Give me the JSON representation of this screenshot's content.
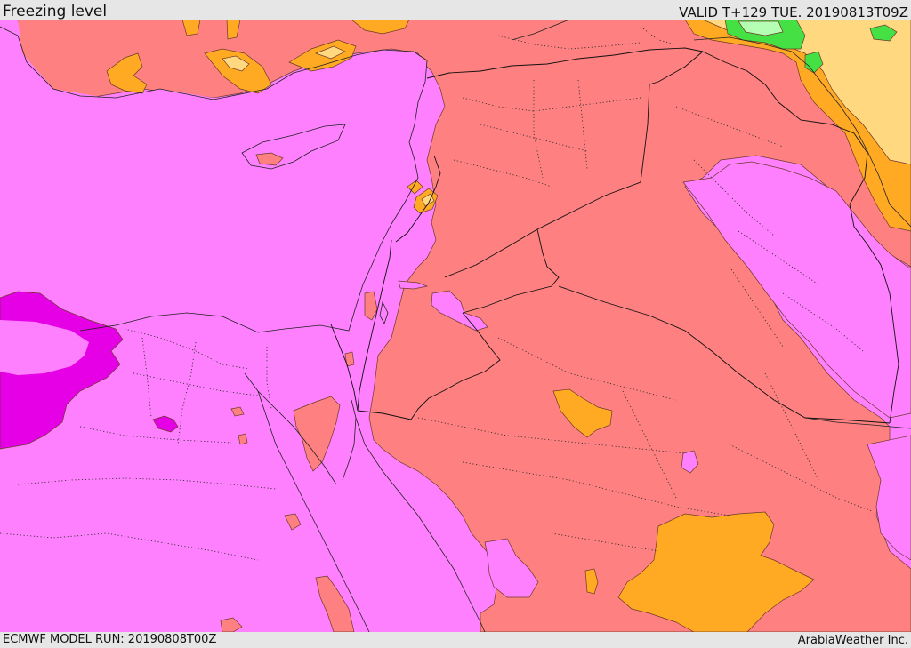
{
  "header": {
    "title": "Freezing level",
    "valid": "VALID T+129 TUE. 20190813T09Z"
  },
  "footer": {
    "model_run": "ECMWF MODEL RUN: 20190808T00Z",
    "credit": "ArabiaWeather Inc."
  },
  "colors": {
    "lowest": "#e600e6",
    "low": "#ff80ff",
    "mid": "#ff8080",
    "high": "#ffaa22",
    "higher": "#ffd880",
    "top": "#44e044",
    "topmost": "#b4ffb4"
  }
}
